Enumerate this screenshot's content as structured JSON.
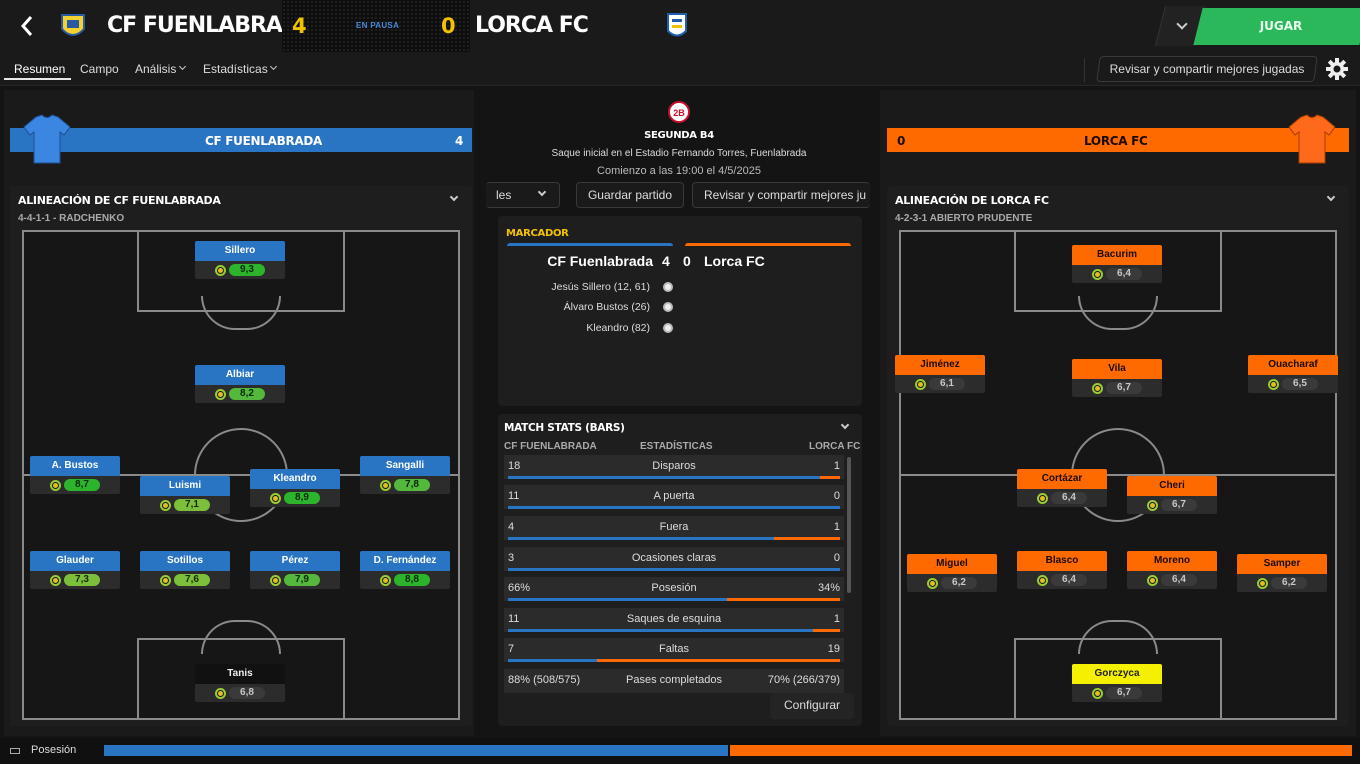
{
  "header": {
    "home_team": "CF FUENLABRADA",
    "away_team": "LORCA FC",
    "home_score": "4",
    "away_score": "0",
    "status": "EN PAUSA",
    "play_label": "JUGAR"
  },
  "tabs": {
    "summary": "Resumen",
    "field": "Campo",
    "analysis": "Análisis",
    "stats": "Estadísticas",
    "review": "Revisar y compartir mejores jugadas"
  },
  "home_banner": {
    "name": "CF FUENLABRADA",
    "score": "4"
  },
  "away_banner": {
    "name": "LORCA FC",
    "score": "0"
  },
  "match_info": {
    "competition": "SEGUNDA B4",
    "venue": "Saque inicial en el Estadio Fernando Torres, Fuenlabrada",
    "kickoff": "Comienzo a las 19:00 el 4/5/2025",
    "badge": "2B"
  },
  "actions": {
    "highlights_partial": "les",
    "save": "Guardar partido",
    "review": "Revisar y compartir mejores ju",
    "configure": "Configurar"
  },
  "scoreboard": {
    "title": "MARCADOR",
    "home": "CF Fuenlabrada",
    "home_score": "4",
    "away_score": "0",
    "away": "Lorca FC",
    "goals": [
      "Jesús Sillero (12, 61)",
      "Álvaro Bustos (26)",
      "Kleandro (82)"
    ]
  },
  "stats": {
    "title": "MATCH STATS (BARS)",
    "home": "CF FUENLABRADA",
    "mid": "ESTADÍSTICAS",
    "away": "LORCA FC",
    "rows": [
      {
        "label": "Disparos",
        "home": "18",
        "away": "1"
      },
      {
        "label": "A puerta",
        "home": "11",
        "away": "0"
      },
      {
        "label": "Fuera",
        "home": "4",
        "away": "1"
      },
      {
        "label": "Ocasiones claras",
        "home": "3",
        "away": "0"
      },
      {
        "label": "Posesión",
        "home": "66%",
        "away": "34%"
      },
      {
        "label": "Saques de esquina",
        "home": "11",
        "away": "1"
      },
      {
        "label": "Faltas",
        "home": "7",
        "away": "19"
      },
      {
        "label": "Pases completados",
        "home": "88% (508/575)",
        "away": "70% (266/379)"
      }
    ]
  },
  "home_lineup": {
    "title": "ALINEACIÓN DE CF FUENLABRADA",
    "formation": "4-4-1-1 - RADCHENKO",
    "players": [
      {
        "name": "Sillero",
        "rating": "9,3"
      },
      {
        "name": "Albiar",
        "rating": "8,2"
      },
      {
        "name": "A. Bustos",
        "rating": "8,7"
      },
      {
        "name": "Luismi",
        "rating": "7,1"
      },
      {
        "name": "Kleandro",
        "rating": "8,9"
      },
      {
        "name": "Sangalli",
        "rating": "7,8"
      },
      {
        "name": "Glauder",
        "rating": "7,3"
      },
      {
        "name": "Sotillos",
        "rating": "7,6"
      },
      {
        "name": "Pérez",
        "rating": "7,9"
      },
      {
        "name": "D. Fernández",
        "rating": "8,8"
      },
      {
        "name": "Tanis",
        "rating": "6,8"
      }
    ]
  },
  "away_lineup": {
    "title": "ALINEACIÓN DE LORCA FC",
    "formation": "4-2-3-1 ABIERTO PRUDENTE",
    "players": [
      {
        "name": "Bacurim",
        "rating": "6,4"
      },
      {
        "name": "Jiménez",
        "rating": "6,1"
      },
      {
        "name": "Vila",
        "rating": "6,7"
      },
      {
        "name": "Ouacharaf",
        "rating": "6,5"
      },
      {
        "name": "Cortázar",
        "rating": "6,4"
      },
      {
        "name": "Cheri",
        "rating": "6,7"
      },
      {
        "name": "Miguel",
        "rating": "6,2"
      },
      {
        "name": "Blasco",
        "rating": "6,4"
      },
      {
        "name": "Moreno",
        "rating": "6,4"
      },
      {
        "name": "Samper",
        "rating": "6,2"
      },
      {
        "name": "Gorczyca",
        "rating": "6,7"
      }
    ]
  },
  "footer": {
    "label": "Posesión",
    "home_possession": 0.5,
    "away_possession": 0.5
  },
  "colors": {
    "home": "#2a74c4",
    "away": "#ff6a00",
    "accent": "#2ab85a",
    "score": "#f2c200"
  }
}
